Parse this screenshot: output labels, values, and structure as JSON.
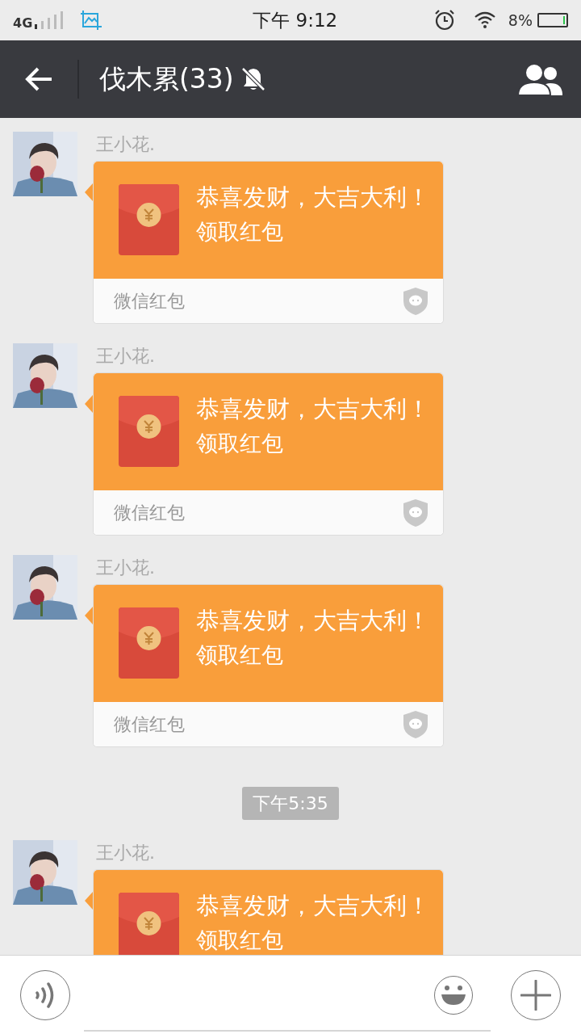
{
  "status_bar": {
    "network": "4G",
    "time": "下午 9:12",
    "battery": "8%"
  },
  "header": {
    "title": "伐木累(33)",
    "muted": true
  },
  "chat": [
    {
      "kind": "message",
      "sender": "王小花.",
      "greeting": "恭喜发财，大吉大利！",
      "action": "领取红包",
      "footer": "微信红包"
    },
    {
      "kind": "message",
      "sender": "王小花.",
      "greeting": "恭喜发财，大吉大利！",
      "action": "领取红包",
      "footer": "微信红包"
    },
    {
      "kind": "message",
      "sender": "王小花.",
      "greeting": "恭喜发财，大吉大利！",
      "action": "领取红包",
      "footer": "微信红包"
    },
    {
      "kind": "time",
      "text": "下午5:35"
    },
    {
      "kind": "message",
      "sender": "王小花.",
      "greeting": "恭喜发财，大吉大利！",
      "action": "领取红包"
    }
  ]
}
